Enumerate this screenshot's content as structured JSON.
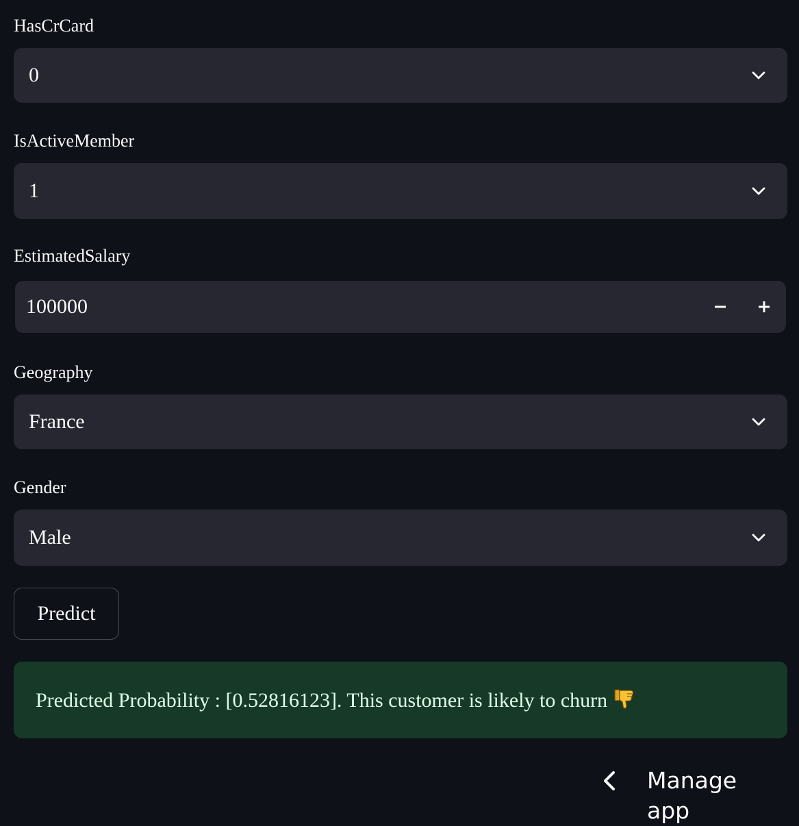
{
  "fields": [
    {
      "label": "HasCrCard",
      "value": "0"
    },
    {
      "label": "IsActiveMember",
      "value": "1"
    },
    {
      "label": "EstimatedSalary",
      "value": "100000"
    },
    {
      "label": "Geography",
      "value": "France"
    },
    {
      "label": "Gender",
      "value": "Male"
    }
  ],
  "stepper": {
    "minus": "−",
    "plus": "+"
  },
  "predict_button": "Predict",
  "result": {
    "message": "Predicted Probability : [0.52816123]. This customer is likely to churn",
    "icon": "thumbs-down-icon"
  },
  "manage_app": "Manage app",
  "colors": {
    "background": "#0e1117",
    "input": "#262730",
    "success_bg": "#173928",
    "success_text": "#dffde9"
  }
}
